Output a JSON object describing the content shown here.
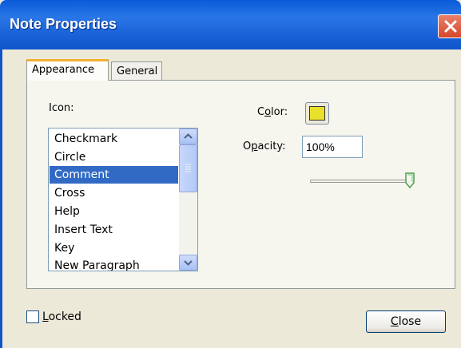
{
  "window": {
    "title": "Note Properties"
  },
  "tabs": [
    {
      "label": "Appearance",
      "active": true
    },
    {
      "label": "General",
      "active": false
    }
  ],
  "icon_section": {
    "label": "Icon:",
    "items": [
      "Checkmark",
      "Circle",
      "Comment",
      "Cross",
      "Help",
      "Insert Text",
      "Key",
      "New Paragraph"
    ],
    "selected": "Comment"
  },
  "color_section": {
    "label_pre": "C",
    "label_u": "o",
    "label_post": "lor:",
    "swatch": "#e8e02a"
  },
  "opacity_section": {
    "label_pre": "O",
    "label_u": "p",
    "label_post": "acity:",
    "value": "100%",
    "slider_fraction": 1.0
  },
  "footer": {
    "locked_u": "L",
    "locked_post": "ocked",
    "locked_checked": false,
    "close_u": "C",
    "close_post": "lose"
  },
  "colors": {
    "titlebar": "#0a5ad9",
    "selection": "#316ac5",
    "dialog_bg": "#ece9d8",
    "tab_accent": "#f0b030"
  }
}
